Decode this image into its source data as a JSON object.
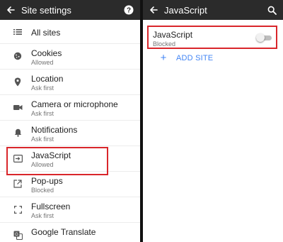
{
  "left_panel": {
    "title": "Site settings",
    "items": [
      {
        "label": "All sites",
        "sub": "",
        "icon": "list-icon"
      },
      {
        "label": "Cookies",
        "sub": "Allowed",
        "icon": "cookie-icon"
      },
      {
        "label": "Location",
        "sub": "Ask first",
        "icon": "location-pin-icon"
      },
      {
        "label": "Camera or microphone",
        "sub": "Ask first",
        "icon": "camera-icon"
      },
      {
        "label": "Notifications",
        "sub": "Ask first",
        "icon": "bell-icon"
      },
      {
        "label": "JavaScript",
        "sub": "Allowed",
        "icon": "javascript-icon"
      },
      {
        "label": "Pop-ups",
        "sub": "Blocked",
        "icon": "popup-icon"
      },
      {
        "label": "Fullscreen",
        "sub": "Ask first",
        "icon": "fullscreen-icon"
      },
      {
        "label": "Google Translate",
        "sub": "",
        "icon": "translate-icon"
      }
    ]
  },
  "right_panel": {
    "title": "JavaScript",
    "setting": {
      "label": "JavaScript",
      "sub": "Blocked",
      "enabled": false
    },
    "add_site_label": "ADD SITE"
  },
  "colors": {
    "appbar": "#2b2b2b",
    "highlight": "#d9262b",
    "accent": "#4285f4"
  }
}
